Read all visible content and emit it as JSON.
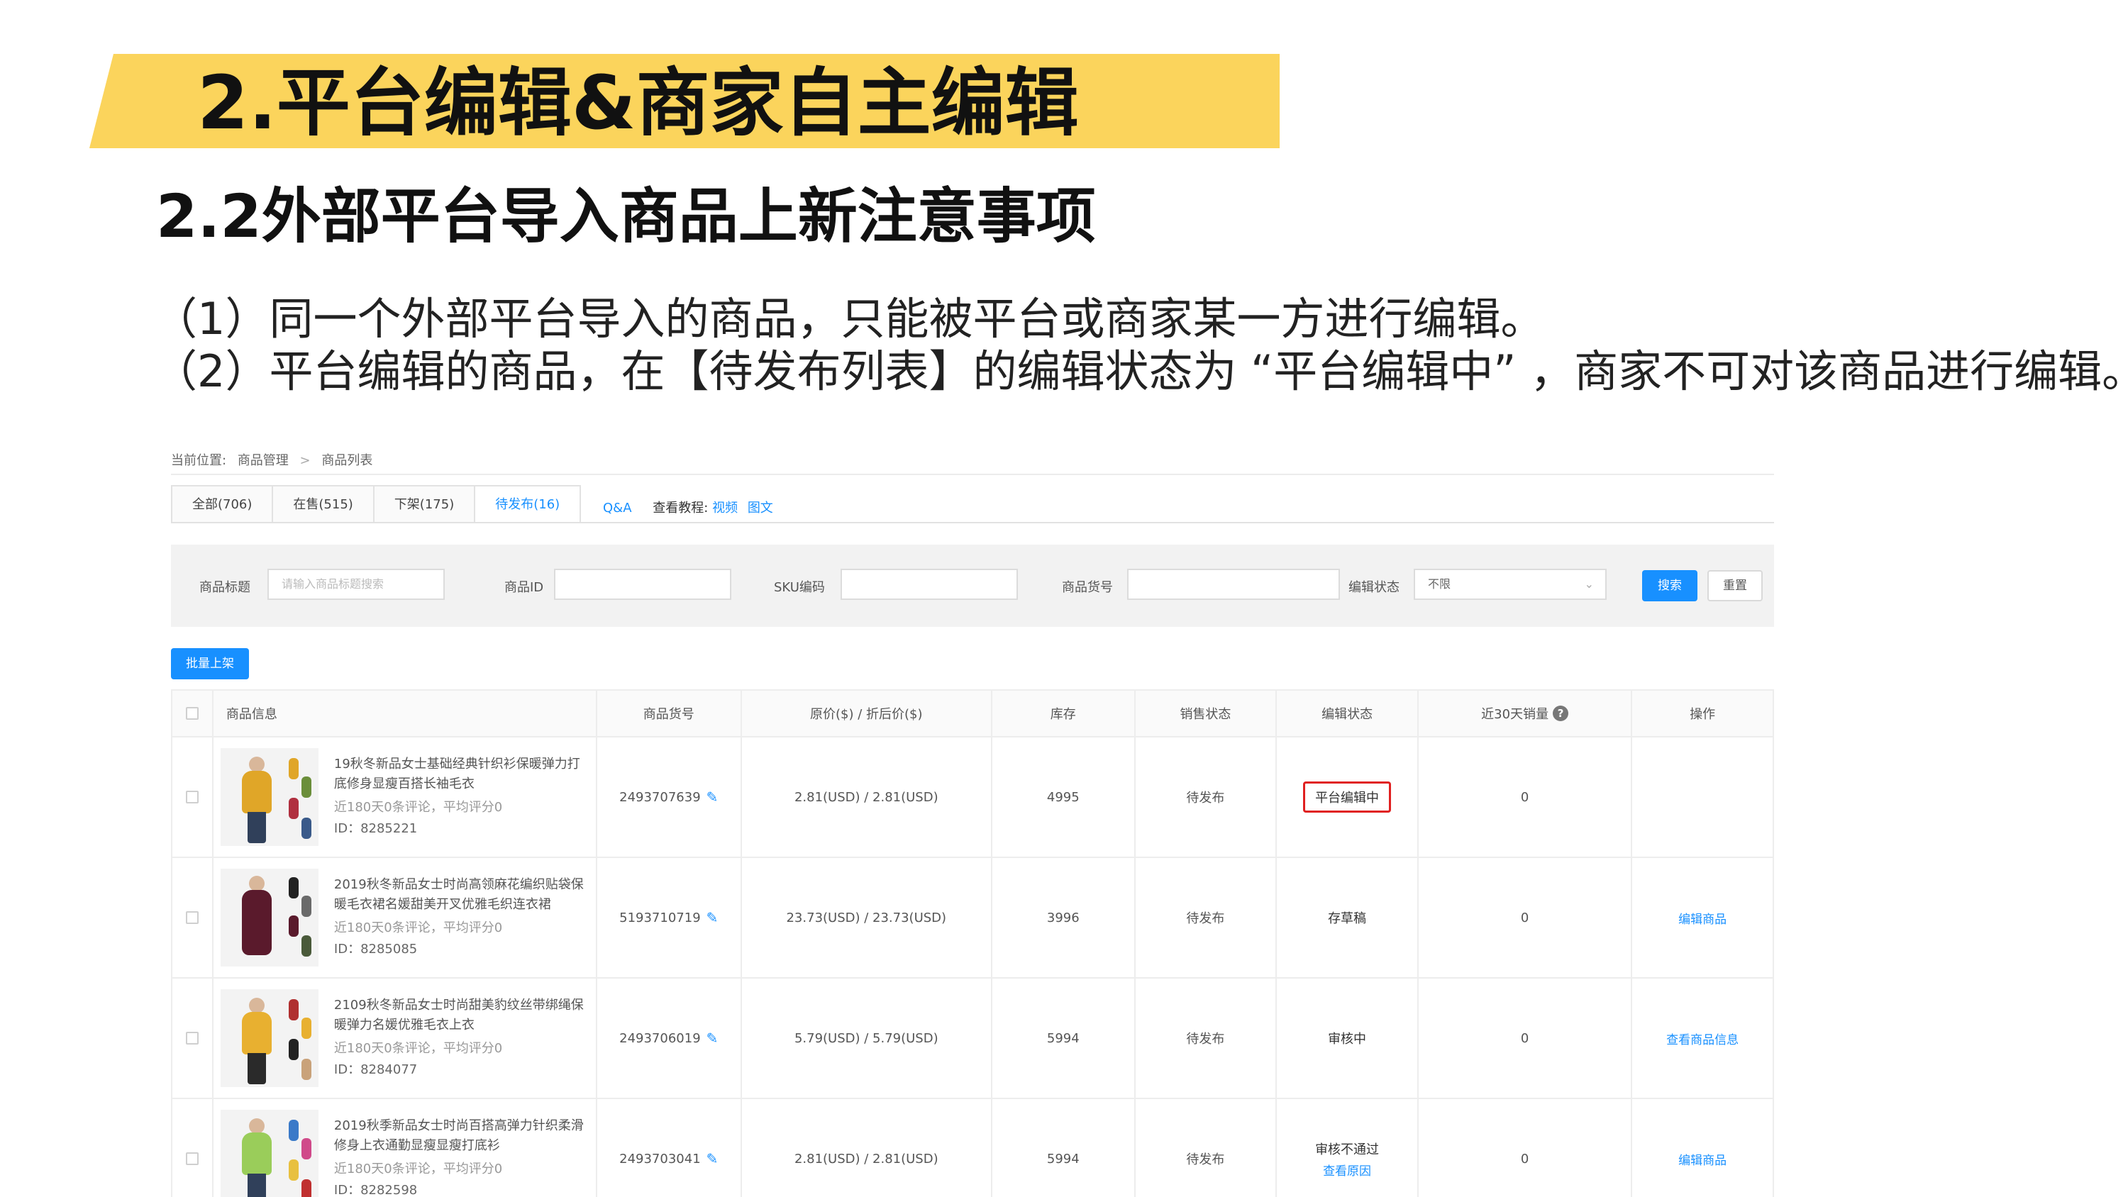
{
  "slide": {
    "title": "2.平台编辑&商家自主编辑",
    "subtitle": "2.2外部平台导入商品上新注意事项",
    "notes": [
      "（1）同一个外部平台导入的商品，只能被平台或商家某一方进行编辑。",
      "（2）平台编辑的商品，在【待发布列表】的编辑状态为 “平台编辑中” ，商家不可对该商品进行编辑。"
    ]
  },
  "breadcrumb": {
    "prefix": "当前位置:",
    "level1": "商品管理",
    "separator": ">",
    "level2": "商品列表"
  },
  "tabs": [
    {
      "label": "全部(706)"
    },
    {
      "label": "在售(515)"
    },
    {
      "label": "下架(175)"
    },
    {
      "label": "待发布(16)"
    }
  ],
  "help": {
    "qa": "Q&A",
    "tutorial_label": "查看教程:",
    "video": "视频",
    "article": "图文"
  },
  "filter": {
    "title_label": "商品标题",
    "title_placeholder": "请输入商品标题搜索",
    "id_label": "商品ID",
    "sku_label": "SKU编码",
    "code_label": "商品货号",
    "edit_status_label": "编辑状态",
    "edit_status_value": "不限",
    "search_button": "搜索",
    "reset_button": "重置"
  },
  "batch_button": "批量上架",
  "table": {
    "headers": {
      "info": "商品信息",
      "sku": "商品货号",
      "price": "原价($) / 折后价($)",
      "stock": "库存",
      "sale_status": "销售状态",
      "edit_status": "编辑状态",
      "sold30": "近30天销量",
      "op": "操作"
    },
    "rows": [
      {
        "title": "19秋冬新品女士基础经典针织衫保暖弹力打底修身显瘦百搭长袖毛衣",
        "meta": "近180天0条评论，平均评分0",
        "id": "ID：8285221",
        "sku": "2493707639",
        "price": "2.81(USD) / 2.81(USD)",
        "stock": "4995",
        "sale_status": "待发布",
        "edit_status": "平台编辑中",
        "edit_sub": "",
        "sold30": "0",
        "op": "",
        "color_main": "#e0a628"
      },
      {
        "title": "2019秋冬新品女士时尚高领麻花编织贴袋保暖毛衣裙名媛甜美开叉优雅毛织连衣裙",
        "meta": "近180天0条评论，平均评分0",
        "id": "ID：8285085",
        "sku": "5193710719",
        "price": "23.73(USD) / 23.73(USD)",
        "stock": "3996",
        "sale_status": "待发布",
        "edit_status": "存草稿",
        "edit_sub": "",
        "sold30": "0",
        "op": "编辑商品",
        "color_main": "#5a1a2c"
      },
      {
        "title": "2109秋冬新品女士时尚甜美豹纹丝带绑绳保暖弹力名媛优雅毛衣上衣",
        "meta": "近180天0条评论，平均评分0",
        "id": "ID：8284077",
        "sku": "2493706019",
        "price": "5.79(USD) / 5.79(USD)",
        "stock": "5994",
        "sale_status": "待发布",
        "edit_status": "审核中",
        "edit_sub": "",
        "sold30": "0",
        "op": "查看商品信息",
        "color_main": "#e8b030"
      },
      {
        "title": "2019秋季新品女士时尚百搭高弹力针织柔滑修身上衣通勤显瘦显瘦打底衫",
        "meta": "近180天0条评论，平均评分0",
        "id": "ID：8282598",
        "sku": "2493703041",
        "price": "2.81(USD) / 2.81(USD)",
        "stock": "5994",
        "sale_status": "待发布",
        "edit_status": "审核不通过",
        "edit_sub": "查看原因",
        "sold30": "0",
        "op": "编辑商品",
        "color_main": "#9acd5a"
      }
    ]
  }
}
